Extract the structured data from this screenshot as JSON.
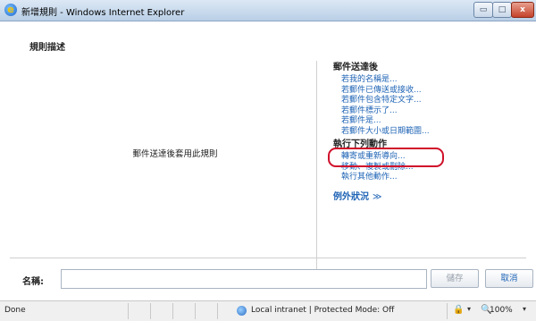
{
  "window": {
    "title": "新增規則 - Windows Internet Explorer",
    "min_glyph": "▭",
    "max_glyph": "□",
    "close_glyph": "x"
  },
  "left_panel": {
    "heading": "規則描述",
    "placeholder_text": "郵件送達後套用此規則"
  },
  "conditions": {
    "heading": "郵件送達後",
    "items": [
      "若我的名稱是...",
      "若郵件已傳送或接收...",
      "若郵件包含特定文字...",
      "若郵件標示了...",
      "若郵件是...",
      "若郵件大小或日期範圍..."
    ]
  },
  "actions": {
    "heading": "執行下列動作",
    "items": [
      "轉寄或重新導向...",
      "移動、複製或刪除...",
      "執行其他動作..."
    ]
  },
  "exceptions": {
    "label": "例外狀況",
    "chevron": "≫"
  },
  "name_field": {
    "label": "名稱:",
    "value": ""
  },
  "buttons": {
    "save": "儲存",
    "cancel": "取消"
  },
  "statusbar": {
    "done": "Done",
    "zone": "Local intranet | Protected Mode: Off",
    "zoom": "100%",
    "security_glyph": "🔒",
    "dropdown_glyph": "▾",
    "zoom_glyph": "🔍"
  },
  "colors": {
    "link": "#1e63b5",
    "highlight_oval": "#d0102a"
  }
}
